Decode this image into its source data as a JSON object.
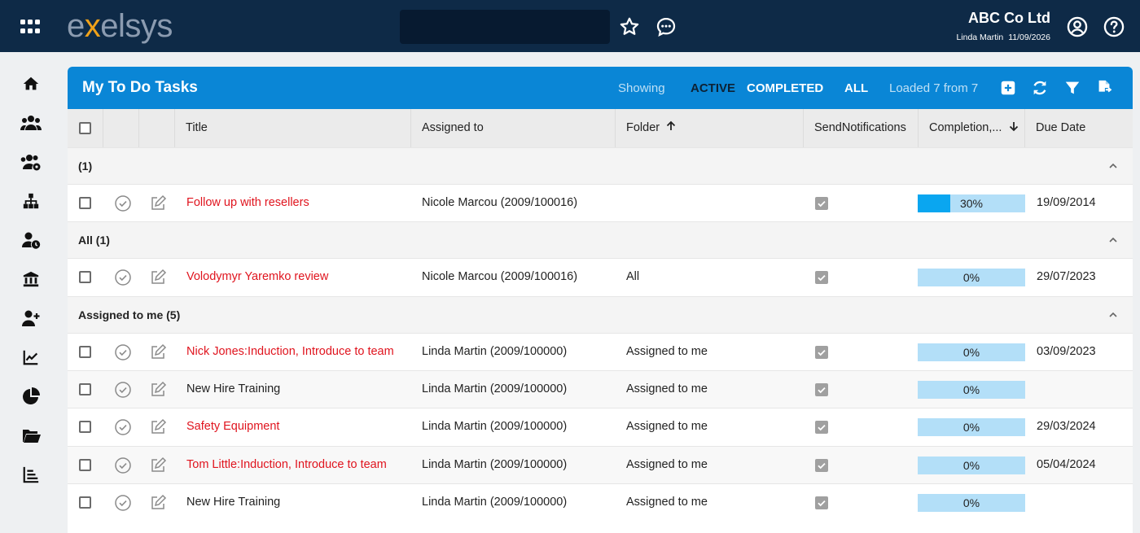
{
  "brand": {
    "logo_pre": "e",
    "logo_x": "x",
    "logo_post": "elsys"
  },
  "header": {
    "company": "ABC Co Ltd",
    "user": "Linda Martin",
    "date": "11/09/2026",
    "search_value": ""
  },
  "panel": {
    "title": "My To Do Tasks",
    "showing": "Showing",
    "filter_active": "ACTIVE",
    "filter_completed": "COMPLETED",
    "filter_all": "ALL",
    "loaded": "Loaded 7 from 7"
  },
  "columns": {
    "title": "Title",
    "assigned": "Assigned to",
    "folder": "Folder",
    "send": "SendNotifications",
    "completion": "Completion,...",
    "due": "Due Date"
  },
  "groups": [
    {
      "label": "(1)",
      "rows": [
        {
          "title": "Follow up with resellers",
          "assigned": "Nicole Marcou (2009/100016)",
          "folder": "",
          "completion": 30,
          "completion_label": "30%",
          "due": "19/09/2014",
          "overdue": true
        }
      ]
    },
    {
      "label": "All (1)",
      "rows": [
        {
          "title": "Volodymyr Yaremko review",
          "assigned": "Nicole Marcou (2009/100016)",
          "folder": "All",
          "completion": 0,
          "completion_label": "0%",
          "due": "29/07/2023",
          "overdue": true
        }
      ]
    },
    {
      "label": "Assigned to me (5)",
      "rows": [
        {
          "title": "Nick Jones:Induction, Introduce to team",
          "assigned": "Linda Martin (2009/100000)",
          "folder": "Assigned to me",
          "completion": 0,
          "completion_label": "0%",
          "due": "03/09/2023",
          "overdue": true
        },
        {
          "title": "New Hire Training",
          "assigned": "Linda Martin (2009/100000)",
          "folder": "Assigned to me",
          "completion": 0,
          "completion_label": "0%",
          "due": "",
          "overdue": false
        },
        {
          "title": "Safety Equipment",
          "assigned": "Linda Martin (2009/100000)",
          "folder": "Assigned to me",
          "completion": 0,
          "completion_label": "0%",
          "due": "29/03/2024",
          "overdue": true
        },
        {
          "title": "Tom Little:Induction, Introduce to team",
          "assigned": "Linda Martin (2009/100000)",
          "folder": "Assigned to me",
          "completion": 0,
          "completion_label": "0%",
          "due": "05/04/2024",
          "overdue": true
        },
        {
          "title": "New Hire Training",
          "assigned": "Linda Martin (2009/100000)",
          "folder": "Assigned to me",
          "completion": 0,
          "completion_label": "0%",
          "due": "",
          "overdue": false
        }
      ]
    }
  ],
  "sidebar": [
    "home-icon",
    "people-icon",
    "people-settings-icon",
    "org-chart-icon",
    "user-clock-icon",
    "bank-icon",
    "add-user-icon",
    "line-chart-icon",
    "pie-chart-icon",
    "folder-icon",
    "bar-list-icon"
  ],
  "colors": {
    "topbar": "#0e2a47",
    "accent": "#0a86d6",
    "overdue": "#e0141e",
    "progress": "#0aa6f0",
    "progress_bg": "#b3dff8"
  }
}
